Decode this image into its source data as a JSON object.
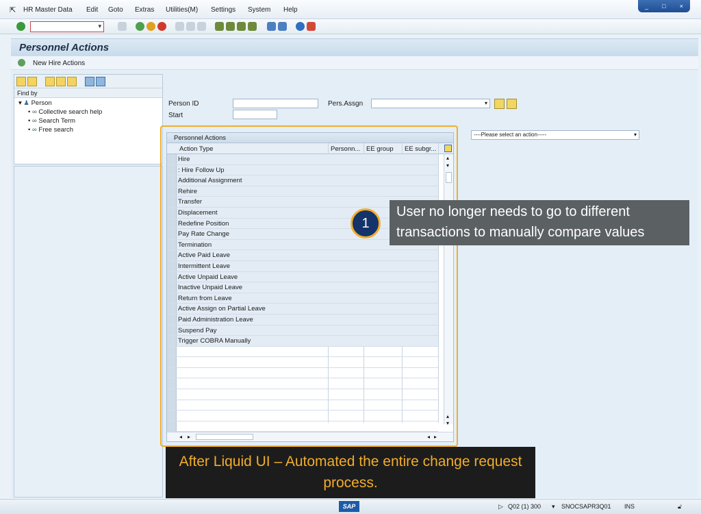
{
  "menu": {
    "items": [
      "HR Master Data",
      "Edit",
      "Goto",
      "Extras",
      "Utilities(M)",
      "Settings",
      "System",
      "Help"
    ]
  },
  "window_controls": [
    "_",
    "□",
    "×"
  ],
  "toolbar": {
    "command_value": ""
  },
  "title": "Personnel Actions",
  "app_toolbar": {
    "new_hire_label": "New Hire Actions"
  },
  "finder": {
    "find_by": "Find by",
    "tree": [
      {
        "label": "Person",
        "level": 0
      },
      {
        "label": "Collective search help",
        "level": 1
      },
      {
        "label": "Search Term",
        "level": 1
      },
      {
        "label": "Free search",
        "level": 1
      }
    ]
  },
  "form": {
    "person_id_label": "Person ID",
    "person_id_value": "",
    "start_label": "Start",
    "start_value": "",
    "pers_assign_label": "Pers.Assgn",
    "pers_assign_value": "",
    "action_select_value": "----Please select an action-----"
  },
  "grid": {
    "title": "Personnel Actions",
    "columns": [
      "Action Type",
      "Personn...",
      "EE group",
      "EE subgr..."
    ],
    "rows": [
      "Hire",
      ": Hire Follow Up",
      "Additional Assignment",
      "Rehire",
      "Transfer",
      "Displacement",
      "Redefine Position",
      "Pay  Rate Change",
      "Termination",
      "Active Paid Leave",
      "Intermittent Leave",
      "Active Unpaid Leave",
      "Inactive Unpaid Leave",
      "Return from Leave",
      "Active Assign on Partial Leave",
      "Paid Administration Leave",
      "Suspend Pay",
      "Trigger COBRA Manually"
    ],
    "empty_rows": 8
  },
  "callout": {
    "number": "1",
    "text": "User no longer needs to go to different transactions to manually compare values"
  },
  "banner": "After Liquid UI – Automated the entire change request process.",
  "status": {
    "sap": "SAP",
    "system": "Q02 (1) 300",
    "server": "SNOCSAPR3Q01",
    "mode": "INS"
  },
  "colors": {
    "accent": "#f2ad2b",
    "callout_bg": "#5b6063",
    "badge": "#14336a"
  }
}
